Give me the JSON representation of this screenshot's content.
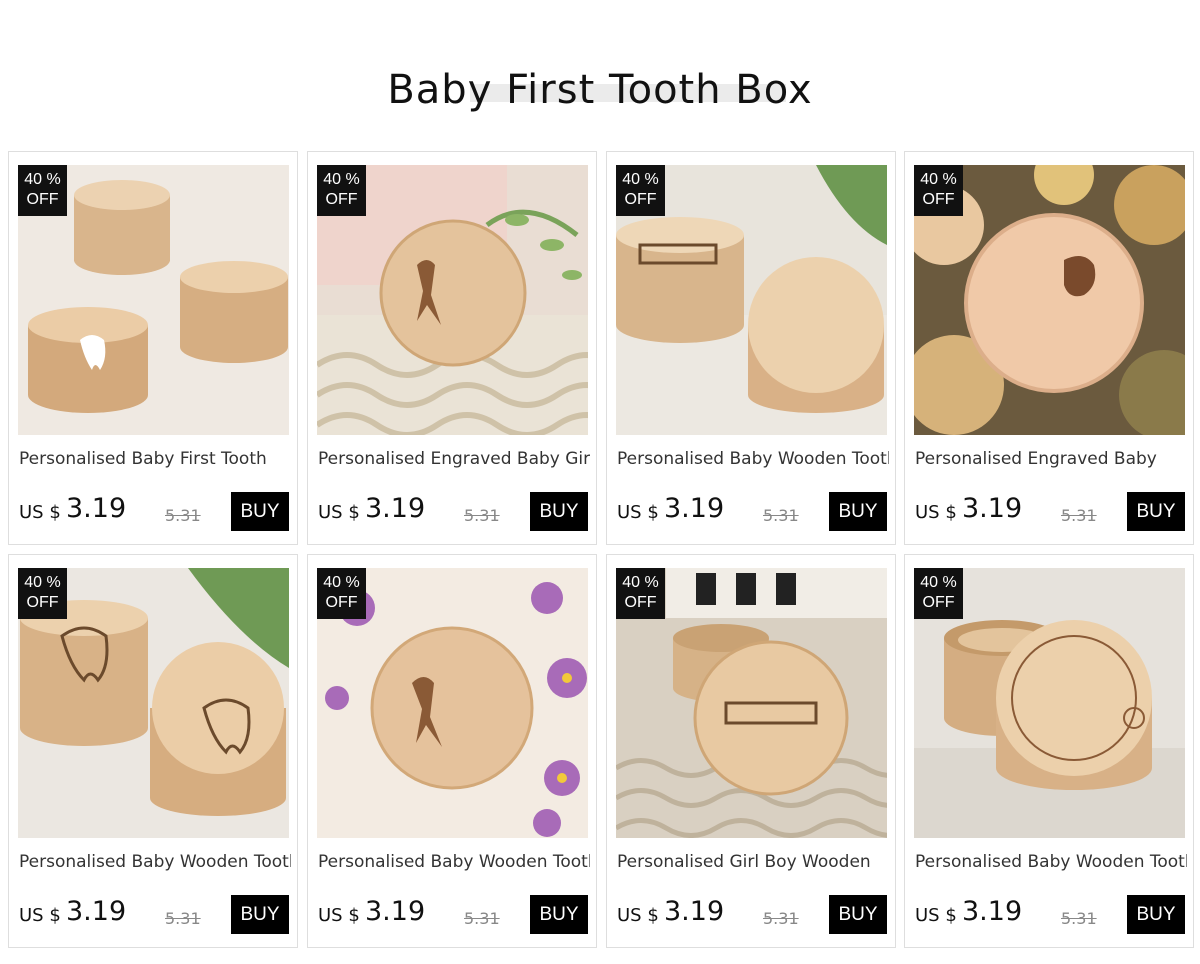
{
  "page": {
    "title": "Baby First Tooth Box"
  },
  "colors": {
    "badge_bg": "#111111",
    "button_bg": "#000000",
    "strike_price": "#888888"
  },
  "products": [
    {
      "badge_top": "40 %",
      "badge_bottom": "OFF",
      "name": "Personalised Baby First Tooth",
      "currency": "US $",
      "price": "3.19",
      "old_price": "5.31",
      "buy_label": "BUY"
    },
    {
      "badge_top": "40 %",
      "badge_bottom": "OFF",
      "name": "Personalised Engraved Baby Girls",
      "currency": "US $",
      "price": "3.19",
      "old_price": "5.31",
      "buy_label": "BUY"
    },
    {
      "badge_top": "40 %",
      "badge_bottom": "OFF",
      "name": "Personalised Baby Wooden Tooth",
      "currency": "US $",
      "price": "3.19",
      "old_price": "5.31",
      "buy_label": "BUY"
    },
    {
      "badge_top": "40 %",
      "badge_bottom": "OFF",
      "name": "Personalised Engraved Baby",
      "currency": "US $",
      "price": "3.19",
      "old_price": "5.31",
      "buy_label": "BUY"
    },
    {
      "badge_top": "40 %",
      "badge_bottom": "OFF",
      "name": "Personalised Baby Wooden Tooth",
      "currency": "US $",
      "price": "3.19",
      "old_price": "5.31",
      "buy_label": "BUY"
    },
    {
      "badge_top": "40 %",
      "badge_bottom": "OFF",
      "name": "Personalised Baby Wooden Tooth",
      "currency": "US $",
      "price": "3.19",
      "old_price": "5.31",
      "buy_label": "BUY"
    },
    {
      "badge_top": "40 %",
      "badge_bottom": "OFF",
      "name": "Personalised Girl Boy Wooden",
      "currency": "US $",
      "price": "3.19",
      "old_price": "5.31",
      "buy_label": "BUY"
    },
    {
      "badge_top": "40 %",
      "badge_bottom": "OFF",
      "name": "Personalised Baby Wooden Tooth",
      "currency": "US $",
      "price": "3.19",
      "old_price": "5.31",
      "buy_label": "BUY"
    }
  ]
}
